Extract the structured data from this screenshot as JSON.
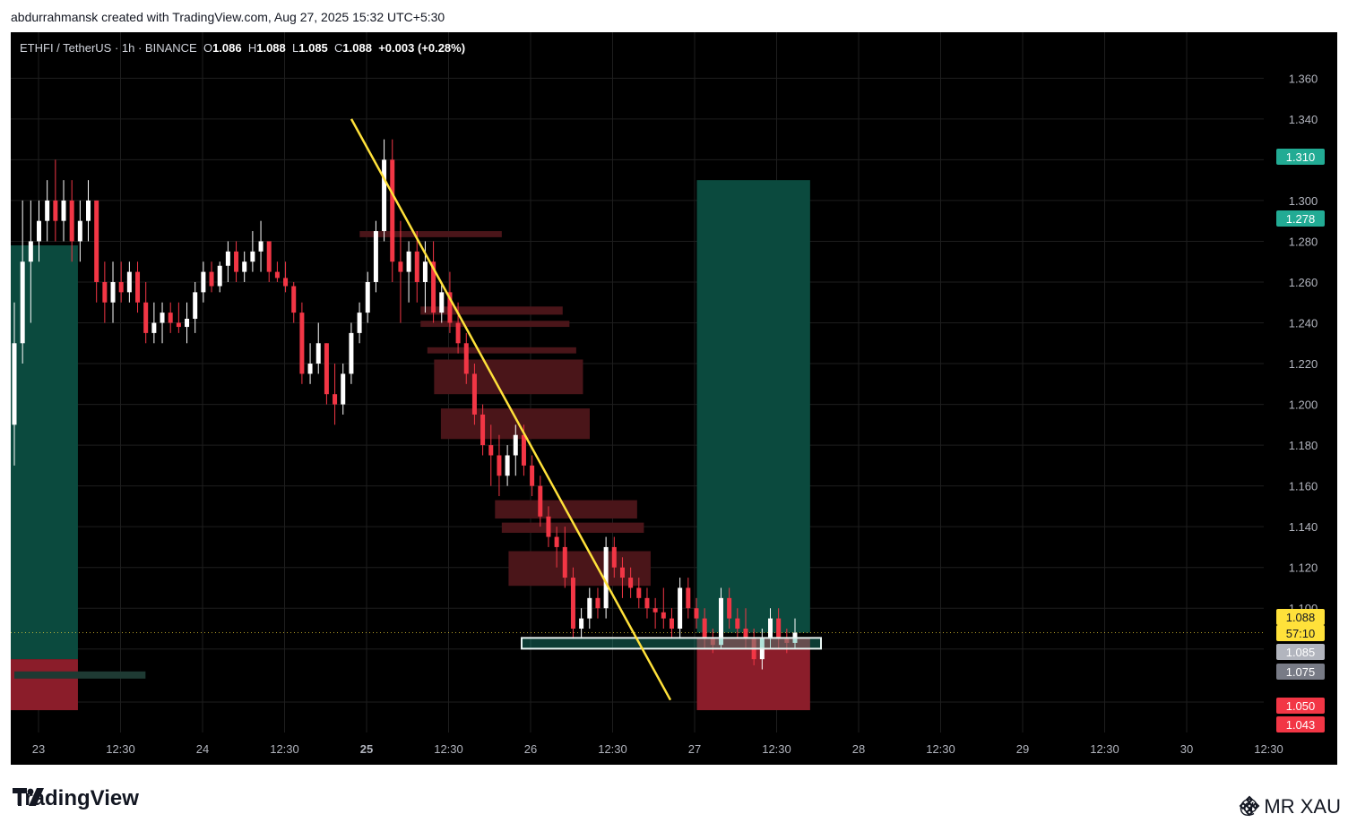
{
  "header": {
    "attribution": "abdurrahmansk created with TradingView.com, Aug 27, 2025 15:32 UTC+5:30"
  },
  "legend": {
    "symbol": "ETHFI / TetherUS · 1h · BINANCE",
    "open_label": "O",
    "open": "1.086",
    "high_label": "H",
    "high": "1.088",
    "low_label": "L",
    "low": "1.085",
    "close_label": "C",
    "close": "1.088",
    "change": "+0.003 (+0.28%)"
  },
  "footer": {
    "brand": "TradingView",
    "author": "@ MR XAU"
  },
  "colors": {
    "background": "#000000",
    "up": "#ffffff",
    "down": "#f23645",
    "grid": "#1e1e1e",
    "trendline": "#ffe13a",
    "target_zone": "#0b4a3e",
    "stop_zone": "#8b1d2a",
    "order_block": "#4a1519",
    "entry_box": "#2a8f87",
    "axis_text": "#b2b5be"
  },
  "chart_data": {
    "type": "candlestick",
    "ylim": [
      1.043,
      1.372
    ],
    "y_ticks": [
      "1.360",
      "1.340",
      "1.320",
      "1.300",
      "1.280",
      "1.260",
      "1.240",
      "1.220",
      "1.200",
      "1.180",
      "1.160",
      "1.140",
      "1.120",
      "1.100",
      "1.080",
      "1.054"
    ],
    "x_ticks": [
      "23",
      "12:30",
      "24",
      "12:30",
      "25",
      "12:30",
      "26",
      "12:30",
      "27",
      "12:30",
      "28",
      "12:30",
      "29",
      "12:30",
      "30",
      "12:30"
    ],
    "price_badges": [
      {
        "label": "1.310",
        "value": 1.31,
        "color": "#22ab94",
        "text_color": "#ffffff"
      },
      {
        "label": "1.278",
        "value": 1.278,
        "color": "#22ab94",
        "text_color": "#ffffff"
      },
      {
        "label": "1.088",
        "value": 1.088,
        "color": "#ffe13a",
        "text_color": "#131722"
      },
      {
        "label": "57:10",
        "value": 1.082,
        "color": "#ffe13a",
        "text_color": "#131722"
      },
      {
        "label": "1.085",
        "value": 1.085,
        "color": "#b2b5be",
        "text_color": "#ffffff"
      },
      {
        "label": "1.075",
        "value": 1.075,
        "color": "#787b86",
        "text_color": "#ffffff"
      },
      {
        "label": "1.050",
        "value": 1.05,
        "color": "#f23645",
        "text_color": "#ffffff"
      },
      {
        "label": "1.043",
        "value": 1.043,
        "color": "#f23645",
        "text_color": "#ffffff"
      }
    ],
    "last_price": 1.088,
    "candles": [
      {
        "o": 1.19,
        "h": 1.25,
        "l": 1.17,
        "c": 1.23
      },
      {
        "o": 1.23,
        "h": 1.3,
        "l": 1.22,
        "c": 1.27
      },
      {
        "o": 1.27,
        "h": 1.3,
        "l": 1.24,
        "c": 1.28
      },
      {
        "o": 1.28,
        "h": 1.3,
        "l": 1.27,
        "c": 1.29
      },
      {
        "o": 1.29,
        "h": 1.31,
        "l": 1.28,
        "c": 1.3
      },
      {
        "o": 1.3,
        "h": 1.32,
        "l": 1.28,
        "c": 1.29
      },
      {
        "o": 1.29,
        "h": 1.31,
        "l": 1.28,
        "c": 1.3
      },
      {
        "o": 1.3,
        "h": 1.31,
        "l": 1.27,
        "c": 1.28
      },
      {
        "o": 1.28,
        "h": 1.3,
        "l": 1.27,
        "c": 1.29
      },
      {
        "o": 1.29,
        "h": 1.31,
        "l": 1.28,
        "c": 1.3
      },
      {
        "o": 1.3,
        "h": 1.3,
        "l": 1.25,
        "c": 1.26
      },
      {
        "o": 1.26,
        "h": 1.27,
        "l": 1.24,
        "c": 1.25
      },
      {
        "o": 1.25,
        "h": 1.27,
        "l": 1.24,
        "c": 1.26
      },
      {
        "o": 1.26,
        "h": 1.27,
        "l": 1.25,
        "c": 1.255
      },
      {
        "o": 1.255,
        "h": 1.27,
        "l": 1.25,
        "c": 1.265
      },
      {
        "o": 1.265,
        "h": 1.27,
        "l": 1.245,
        "c": 1.25
      },
      {
        "o": 1.25,
        "h": 1.26,
        "l": 1.23,
        "c": 1.235
      },
      {
        "o": 1.235,
        "h": 1.25,
        "l": 1.23,
        "c": 1.24
      },
      {
        "o": 1.24,
        "h": 1.25,
        "l": 1.23,
        "c": 1.245
      },
      {
        "o": 1.245,
        "h": 1.25,
        "l": 1.235,
        "c": 1.24
      },
      {
        "o": 1.24,
        "h": 1.25,
        "l": 1.235,
        "c": 1.238
      },
      {
        "o": 1.238,
        "h": 1.25,
        "l": 1.23,
        "c": 1.242
      },
      {
        "o": 1.242,
        "h": 1.26,
        "l": 1.235,
        "c": 1.255
      },
      {
        "o": 1.255,
        "h": 1.27,
        "l": 1.25,
        "c": 1.265
      },
      {
        "o": 1.265,
        "h": 1.27,
        "l": 1.255,
        "c": 1.258
      },
      {
        "o": 1.258,
        "h": 1.27,
        "l": 1.255,
        "c": 1.268
      },
      {
        "o": 1.268,
        "h": 1.28,
        "l": 1.26,
        "c": 1.275
      },
      {
        "o": 1.275,
        "h": 1.28,
        "l": 1.26,
        "c": 1.265
      },
      {
        "o": 1.265,
        "h": 1.275,
        "l": 1.26,
        "c": 1.27
      },
      {
        "o": 1.27,
        "h": 1.285,
        "l": 1.265,
        "c": 1.275
      },
      {
        "o": 1.275,
        "h": 1.29,
        "l": 1.265,
        "c": 1.28
      },
      {
        "o": 1.28,
        "h": 1.28,
        "l": 1.26,
        "c": 1.265
      },
      {
        "o": 1.265,
        "h": 1.27,
        "l": 1.26,
        "c": 1.262
      },
      {
        "o": 1.262,
        "h": 1.27,
        "l": 1.255,
        "c": 1.258
      },
      {
        "o": 1.258,
        "h": 1.26,
        "l": 1.24,
        "c": 1.245
      },
      {
        "o": 1.245,
        "h": 1.25,
        "l": 1.21,
        "c": 1.215
      },
      {
        "o": 1.215,
        "h": 1.23,
        "l": 1.21,
        "c": 1.22
      },
      {
        "o": 1.22,
        "h": 1.24,
        "l": 1.215,
        "c": 1.23
      },
      {
        "o": 1.23,
        "h": 1.23,
        "l": 1.2,
        "c": 1.205
      },
      {
        "o": 1.205,
        "h": 1.22,
        "l": 1.19,
        "c": 1.2
      },
      {
        "o": 1.2,
        "h": 1.22,
        "l": 1.195,
        "c": 1.215
      },
      {
        "o": 1.215,
        "h": 1.24,
        "l": 1.21,
        "c": 1.235
      },
      {
        "o": 1.235,
        "h": 1.25,
        "l": 1.23,
        "c": 1.245
      },
      {
        "o": 1.245,
        "h": 1.265,
        "l": 1.24,
        "c": 1.26
      },
      {
        "o": 1.26,
        "h": 1.29,
        "l": 1.255,
        "c": 1.285
      },
      {
        "o": 1.285,
        "h": 1.33,
        "l": 1.28,
        "c": 1.32
      },
      {
        "o": 1.32,
        "h": 1.33,
        "l": 1.26,
        "c": 1.27
      },
      {
        "o": 1.27,
        "h": 1.29,
        "l": 1.24,
        "c": 1.265
      },
      {
        "o": 1.265,
        "h": 1.28,
        "l": 1.25,
        "c": 1.275
      },
      {
        "o": 1.275,
        "h": 1.285,
        "l": 1.25,
        "c": 1.26
      },
      {
        "o": 1.26,
        "h": 1.28,
        "l": 1.245,
        "c": 1.27
      },
      {
        "o": 1.27,
        "h": 1.28,
        "l": 1.24,
        "c": 1.245
      },
      {
        "o": 1.245,
        "h": 1.26,
        "l": 1.24,
        "c": 1.255
      },
      {
        "o": 1.255,
        "h": 1.265,
        "l": 1.235,
        "c": 1.24
      },
      {
        "o": 1.24,
        "h": 1.25,
        "l": 1.225,
        "c": 1.23
      },
      {
        "o": 1.23,
        "h": 1.235,
        "l": 1.21,
        "c": 1.215
      },
      {
        "o": 1.215,
        "h": 1.22,
        "l": 1.19,
        "c": 1.195
      },
      {
        "o": 1.195,
        "h": 1.2,
        "l": 1.175,
        "c": 1.18
      },
      {
        "o": 1.18,
        "h": 1.19,
        "l": 1.16,
        "c": 1.175
      },
      {
        "o": 1.175,
        "h": 1.185,
        "l": 1.155,
        "c": 1.165
      },
      {
        "o": 1.165,
        "h": 1.18,
        "l": 1.16,
        "c": 1.175
      },
      {
        "o": 1.175,
        "h": 1.19,
        "l": 1.165,
        "c": 1.185
      },
      {
        "o": 1.185,
        "h": 1.19,
        "l": 1.165,
        "c": 1.17
      },
      {
        "o": 1.17,
        "h": 1.175,
        "l": 1.155,
        "c": 1.16
      },
      {
        "o": 1.16,
        "h": 1.165,
        "l": 1.14,
        "c": 1.145
      },
      {
        "o": 1.145,
        "h": 1.15,
        "l": 1.13,
        "c": 1.135
      },
      {
        "o": 1.135,
        "h": 1.14,
        "l": 1.12,
        "c": 1.13
      },
      {
        "o": 1.13,
        "h": 1.14,
        "l": 1.11,
        "c": 1.115
      },
      {
        "o": 1.115,
        "h": 1.12,
        "l": 1.085,
        "c": 1.09
      },
      {
        "o": 1.09,
        "h": 1.1,
        "l": 1.085,
        "c": 1.095
      },
      {
        "o": 1.095,
        "h": 1.11,
        "l": 1.09,
        "c": 1.105
      },
      {
        "o": 1.105,
        "h": 1.11,
        "l": 1.095,
        "c": 1.1
      },
      {
        "o": 1.1,
        "h": 1.135,
        "l": 1.095,
        "c": 1.13
      },
      {
        "o": 1.13,
        "h": 1.135,
        "l": 1.115,
        "c": 1.12
      },
      {
        "o": 1.12,
        "h": 1.125,
        "l": 1.105,
        "c": 1.115
      },
      {
        "o": 1.115,
        "h": 1.12,
        "l": 1.105,
        "c": 1.11
      },
      {
        "o": 1.11,
        "h": 1.115,
        "l": 1.1,
        "c": 1.105
      },
      {
        "o": 1.105,
        "h": 1.11,
        "l": 1.095,
        "c": 1.1
      },
      {
        "o": 1.1,
        "h": 1.105,
        "l": 1.09,
        "c": 1.098
      },
      {
        "o": 1.098,
        "h": 1.11,
        "l": 1.09,
        "c": 1.095
      },
      {
        "o": 1.095,
        "h": 1.1,
        "l": 1.085,
        "c": 1.09
      },
      {
        "o": 1.09,
        "h": 1.115,
        "l": 1.085,
        "c": 1.11
      },
      {
        "o": 1.11,
        "h": 1.115,
        "l": 1.095,
        "c": 1.1
      },
      {
        "o": 1.1,
        "h": 1.105,
        "l": 1.09,
        "c": 1.095
      },
      {
        "o": 1.095,
        "h": 1.1,
        "l": 1.08,
        "c": 1.085
      },
      {
        "o": 1.085,
        "h": 1.09,
        "l": 1.078,
        "c": 1.082
      },
      {
        "o": 1.082,
        "h": 1.11,
        "l": 1.08,
        "c": 1.105
      },
      {
        "o": 1.105,
        "h": 1.11,
        "l": 1.09,
        "c": 1.095
      },
      {
        "o": 1.095,
        "h": 1.1,
        "l": 1.085,
        "c": 1.09
      },
      {
        "o": 1.09,
        "h": 1.1,
        "l": 1.08,
        "c": 1.085
      },
      {
        "o": 1.085,
        "h": 1.09,
        "l": 1.072,
        "c": 1.075
      },
      {
        "o": 1.075,
        "h": 1.09,
        "l": 1.07,
        "c": 1.085
      },
      {
        "o": 1.085,
        "h": 1.1,
        "l": 1.08,
        "c": 1.095
      },
      {
        "o": 1.095,
        "h": 1.1,
        "l": 1.08,
        "c": 1.085
      },
      {
        "o": 1.085,
        "h": 1.09,
        "l": 1.078,
        "c": 1.083
      },
      {
        "o": 1.083,
        "h": 1.095,
        "l": 1.08,
        "c": 1.088
      }
    ],
    "annotations": {
      "trendline": {
        "from": {
          "candle": 45,
          "price": 1.34
        },
        "to": {
          "candle": 88,
          "price": 1.055
        }
      },
      "order_blocks": [
        {
          "from_candle": 46,
          "to_candle": 67,
          "top": 1.285,
          "bottom": 1.282
        },
        {
          "from_candle": 55,
          "to_candle": 76,
          "top": 1.248,
          "bottom": 1.244
        },
        {
          "from_candle": 55,
          "to_candle": 77,
          "top": 1.241,
          "bottom": 1.238
        },
        {
          "from_candle": 56,
          "to_candle": 78,
          "top": 1.228,
          "bottom": 1.225
        },
        {
          "from_candle": 57,
          "to_candle": 79,
          "top": 1.222,
          "bottom": 1.205
        },
        {
          "from_candle": 58,
          "to_candle": 80,
          "top": 1.198,
          "bottom": 1.183
        },
        {
          "from_candle": 66,
          "to_candle": 87,
          "top": 1.153,
          "bottom": 1.144
        },
        {
          "from_candle": 67,
          "to_candle": 88,
          "top": 1.142,
          "bottom": 1.137
        },
        {
          "from_candle": 68,
          "to_candle": 89,
          "top": 1.128,
          "bottom": 1.111
        }
      ],
      "long_position_left": {
        "from_candle": 0,
        "to_candle": 9,
        "target_top": 1.278,
        "entry": 1.075,
        "stop_bottom": 1.05
      },
      "long_position_right": {
        "from_candle": 90,
        "to_candle": 107,
        "target_top": 1.31,
        "entry": 1.088,
        "stop_bottom": 1.05
      },
      "entry_box": {
        "from_candle": 68,
        "to_candle": 108,
        "top": 1.085,
        "bottom": 1.079
      },
      "side_marker": {
        "from_candle": 0,
        "to_candle": 17,
        "top": 1.069,
        "bottom": 1.067
      }
    }
  }
}
